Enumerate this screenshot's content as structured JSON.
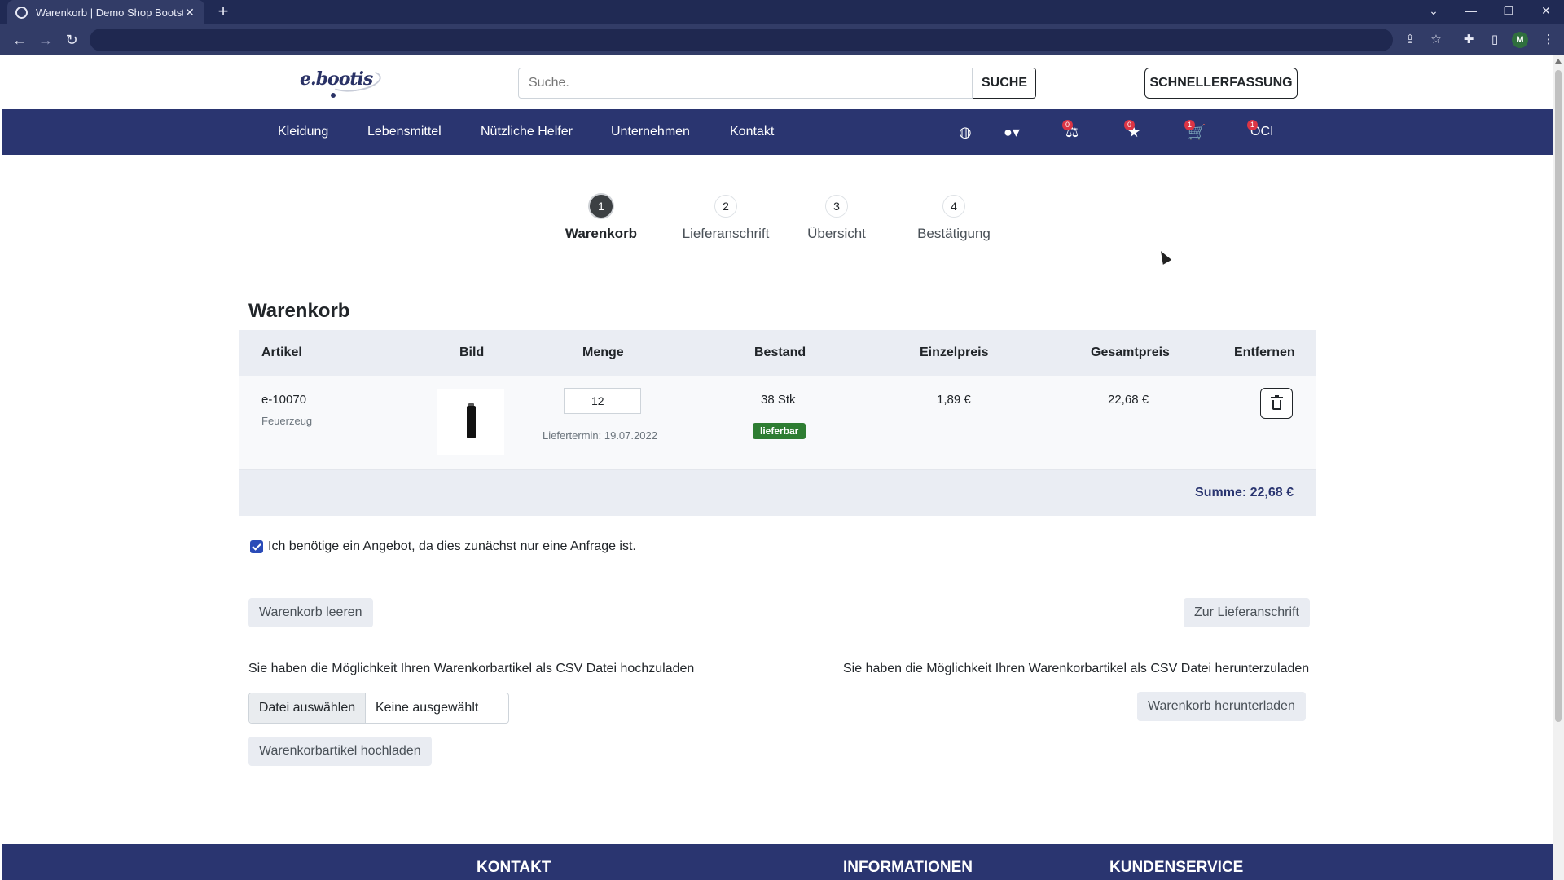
{
  "browser": {
    "tab_title": "Warenkorb | Demo Shop Bootstr",
    "tab_close": "✕",
    "new_tab": "+",
    "profile_initial": "M"
  },
  "header": {
    "logo_text": "e.bootis",
    "search_placeholder": "Suche.",
    "search_button": "SUCHE",
    "quick_entry_button": "SCHNELLERFASSUNG"
  },
  "nav": {
    "links": [
      "Kleidung",
      "Lebensmittel",
      "Nützliche Helfer",
      "Unternehmen",
      "Kontakt"
    ],
    "compare_count": "0",
    "wishlist_count": "0",
    "cart_count": "1",
    "oci_count": "1",
    "oci_label": "OCI"
  },
  "stepper": [
    {
      "number": "1",
      "label": "Warenkorb",
      "active": true
    },
    {
      "number": "2",
      "label": "Lieferanschrift",
      "active": false
    },
    {
      "number": "3",
      "label": "Übersicht",
      "active": false
    },
    {
      "number": "4",
      "label": "Bestätigung",
      "active": false
    }
  ],
  "cart": {
    "title": "Warenkorb",
    "columns": [
      "Artikel",
      "Bild",
      "Menge",
      "Bestand",
      "Einzelpreis",
      "Gesamtpreis",
      "Entfernen"
    ],
    "items": [
      {
        "article_number": "e-10070",
        "article_name": "Feuerzeug",
        "quantity": "12",
        "delivery_date": "Liefertermin: 19.07.2022",
        "stock": "38 Stk",
        "status": "lieferbar",
        "unit_price": "1,89 €",
        "total_price": "22,68 €"
      }
    ],
    "sum": "Summe: 22,68 €"
  },
  "options": {
    "quote_checkbox_label": "Ich benötige ein Angebot, da dies zunächst nur eine Anfrage ist.",
    "quote_checked": true
  },
  "actions": {
    "clear_cart": "Warenkorb leeren",
    "to_delivery": "Zur Lieferanschrift"
  },
  "csv": {
    "upload_info": "Sie haben die Möglichkeit Ihren Warenkorbartikel als CSV Datei hochzuladen",
    "download_info": "Sie haben die Möglichkeit Ihren Warenkorbartikel als CSV Datei herunterzuladen",
    "choose_file": "Datei auswählen",
    "no_file": "Keine ausgewählt",
    "upload_button": "Warenkorbartikel hochladen",
    "download_button": "Warenkorb herunterladen"
  },
  "footer": {
    "headings": [
      "KONTAKT",
      "INFORMATIONEN",
      "KUNDENSERVICE"
    ]
  },
  "colors": {
    "nav_bg": "#2a3570",
    "status_green": "#2e7d32",
    "badge_red": "#dc3545"
  }
}
